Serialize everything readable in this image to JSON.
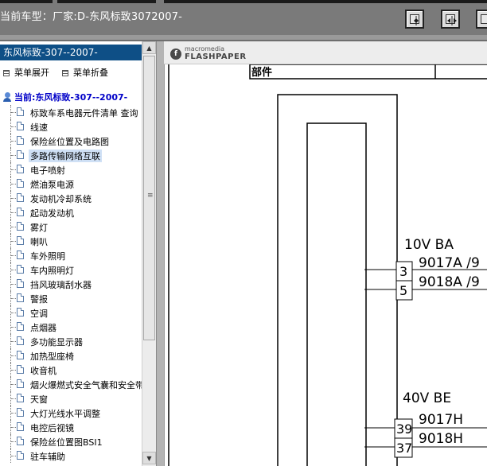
{
  "window": {
    "title": "当前车型：厂家:D-东风标致3072007-"
  },
  "toolbar": {
    "buttons": [
      {
        "name": "view-button-1"
      },
      {
        "name": "view-button-2"
      },
      {
        "name": "view-button-3"
      }
    ]
  },
  "sidebar": {
    "header": "东风标致-307--2007-",
    "expand_label": "菜单展开",
    "collapse_label": "菜单折叠",
    "root_label": "当前:东风标致-307--2007-",
    "items": [
      {
        "label": "标致车系电器元件清单 查询"
      },
      {
        "label": "线速"
      },
      {
        "label": "保险丝位置及电路图"
      },
      {
        "label": "多路传输网络互联",
        "selected": true
      },
      {
        "label": "电子喷射"
      },
      {
        "label": "燃油泵电源"
      },
      {
        "label": "发动机冷却系统"
      },
      {
        "label": "起动发动机"
      },
      {
        "label": "雾灯"
      },
      {
        "label": "喇叭"
      },
      {
        "label": "车外照明"
      },
      {
        "label": "车内照明灯"
      },
      {
        "label": "挡风玻璃刮水器"
      },
      {
        "label": "警报"
      },
      {
        "label": "空调"
      },
      {
        "label": "点烟器"
      },
      {
        "label": "多功能显示器"
      },
      {
        "label": "加热型座椅"
      },
      {
        "label": "收音机"
      },
      {
        "label": "烟火爆燃式安全气囊和安全带"
      },
      {
        "label": "天窗"
      },
      {
        "label": "大灯光线水平调整"
      },
      {
        "label": "电控后视镜"
      },
      {
        "label": "保险丝位置图BSI1"
      },
      {
        "label": "驻车辅助"
      }
    ]
  },
  "viewer": {
    "logo_top": "macromedia",
    "logo_bottom": "FLASHPAPER",
    "table_header": "部件",
    "connector1_label": "10V  BA",
    "connector1_pins": [
      {
        "pin": "3",
        "wire": "9017A /9"
      },
      {
        "pin": "5",
        "wire": "9018A /9"
      }
    ],
    "connector2_label": "40V  BE",
    "connector2_pins": [
      {
        "pin": "39",
        "wire": "9017H"
      },
      {
        "pin": "37",
        "wire": "9018H"
      }
    ]
  }
}
